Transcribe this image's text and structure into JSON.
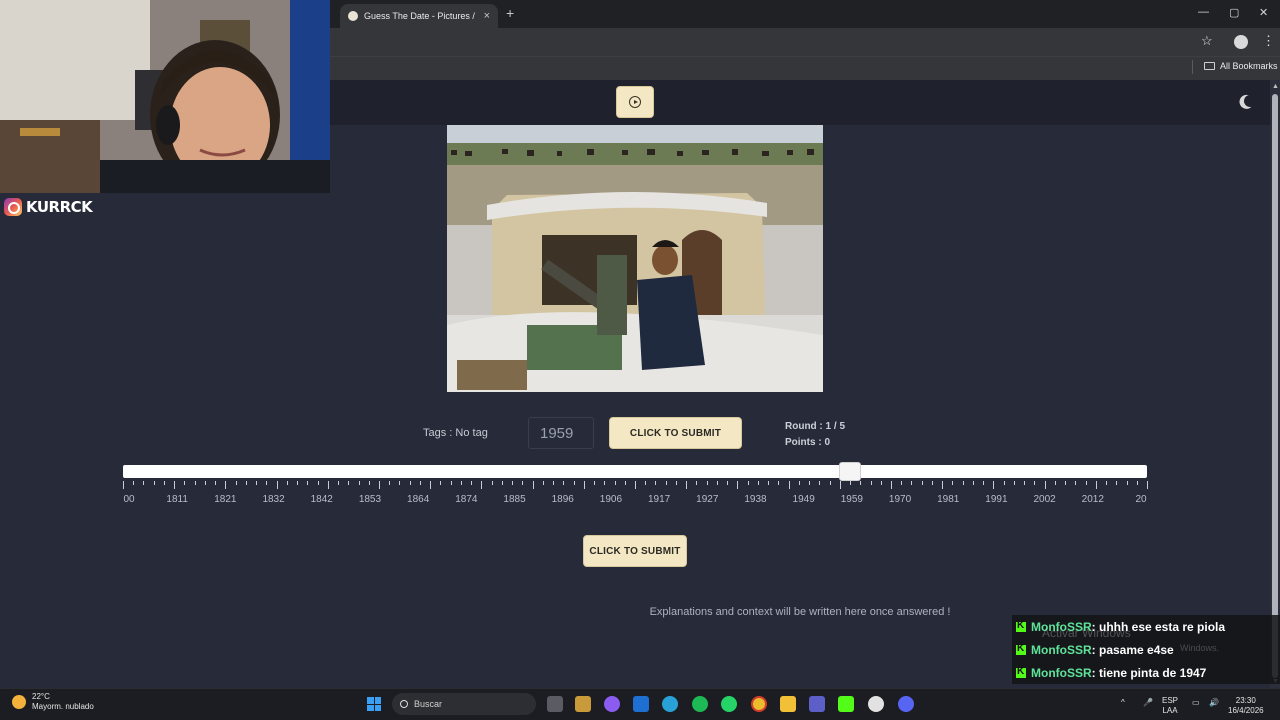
{
  "browser": {
    "tab_title": "Guess The Date - Pictures / Pai",
    "tab_close": "×",
    "new_tab": "+",
    "window_controls": [
      "—",
      "▢",
      "✕"
    ],
    "bookmarks_label": "All Bookmarks"
  },
  "webcam": {
    "instagram_handle": "KURRCK"
  },
  "game": {
    "tags_text": "Tags : No tag",
    "year_value": "1959",
    "submit_label": "CLICK TO SUBMIT",
    "round_text": "Round : 1 / 5",
    "points_text": "Points : 0",
    "slider_value": 1959,
    "slider_min": 1800,
    "slider_max": 2024,
    "tick_labels": [
      "00",
      "1811",
      "1821",
      "1832",
      "1842",
      "1853",
      "1864",
      "1874",
      "1885",
      "1896",
      "1906",
      "1917",
      "1927",
      "1938",
      "1949",
      "1959",
      "1970",
      "1981",
      "1991",
      "2002",
      "2012",
      "20"
    ],
    "submit_bottom_label": "CLICK TO SUBMIT",
    "explanation_text": "Explanations and context will be written here once answered !"
  },
  "chat": [
    {
      "user": "MonfoSSR",
      "message": " : uhhh ese esta re piola"
    },
    {
      "user": "MonfoSSR",
      "message": " : pasame e4se"
    },
    {
      "user": "MonfoSSR",
      "message": " : tiene pinta de 1947"
    }
  ],
  "windows_watermark": {
    "line1": "Activar Windows",
    "line2": "Windows."
  },
  "taskbar": {
    "weather_temp": "22°C",
    "weather_desc": "Mayorm. nublado",
    "search_placeholder": "Buscar",
    "lang_top": "ESP",
    "lang_bottom": "LAA",
    "time": "23:30",
    "date": "16/4/2026"
  },
  "colors": {
    "page_bg": "#272b39",
    "button_bg": "#f4e7c3",
    "header_bg": "#1f222c",
    "chat_user": "#5fe39a"
  }
}
